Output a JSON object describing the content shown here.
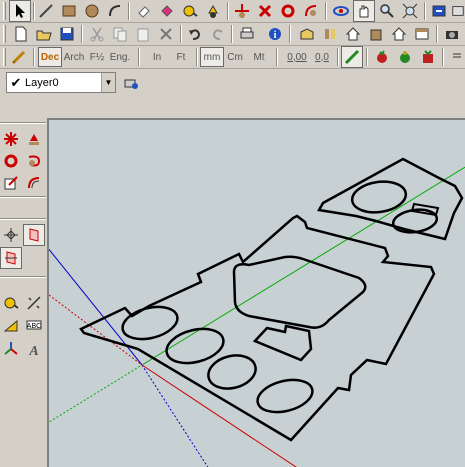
{
  "window": {
    "active_layer": "Layer0"
  },
  "units": {
    "arch_formats": [
      "Dec",
      "Arch",
      "F½",
      "Eng."
    ],
    "imperial": [
      "In",
      "Ft"
    ],
    "metric": [
      "mm",
      "Cm",
      "Mt"
    ],
    "precision": [
      "0,00",
      "0,0"
    ]
  },
  "icons": {
    "row1": [
      "select-arrow-icon",
      "line-pencil-icon",
      "rectangle-icon",
      "circle-icon",
      "arc-icon",
      "eraser-icon",
      "paint-bucket-icon",
      "tape-measure-icon",
      "push-pull-icon",
      "move-icon",
      "rotate-icon",
      "offset-icon",
      "orbit-icon",
      "pan-icon",
      "zoom-icon",
      "zoom-extents-icon",
      "previous-view-icon"
    ],
    "row2": [
      "new-icon",
      "open-icon",
      "save-icon",
      "cut-icon",
      "copy-icon",
      "paste-icon",
      "delete-icon",
      "undo-icon",
      "redo-icon",
      "print-icon",
      "model-info-icon",
      "iso-view-icon",
      "top-view-icon",
      "front-view-icon",
      "right-view-icon",
      "back-view-icon",
      "left-view-icon",
      "camera-icon"
    ],
    "left": [
      "move-tool-icon",
      "push-pull-tool-icon",
      "rotate-tool-icon",
      "follow-me-icon",
      "scale-tool-icon",
      "offset-tool-icon",
      "section-plane-icon",
      "section-display-icon",
      "section-cut-icon",
      "tape-measure-tool-icon",
      "dimension-icon",
      "protractor-icon",
      "text-icon",
      "axes-icon",
      "3d-text-icon"
    ]
  },
  "colors": {
    "axis_red": "#cc0000",
    "axis_green": "#00aa00",
    "axis_blue": "#0000cc",
    "viewport_bg": "#c7d0d3"
  }
}
